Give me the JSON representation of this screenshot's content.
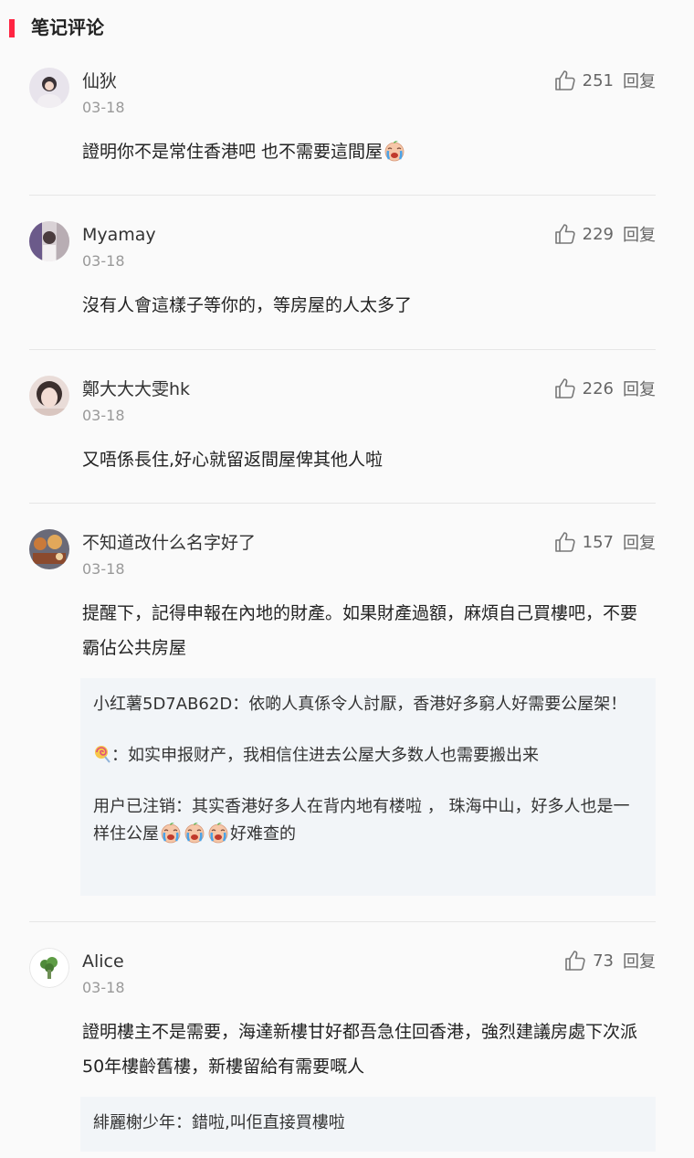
{
  "section": {
    "title": "笔记评论"
  },
  "comments": [
    {
      "username": "仙狄",
      "date": "03-18",
      "likes": "251",
      "reply_label": "回复",
      "text": "證明你不是常住香港吧 也不需要這間屋",
      "emoji": "crying-baby-emoji"
    },
    {
      "username": "Myamay",
      "date": "03-18",
      "likes": "229",
      "reply_label": "回复",
      "text": "沒有人會這樣子等你的，等房屋的人太多了"
    },
    {
      "username": "鄭大大大雯hk",
      "date": "03-18",
      "likes": "226",
      "reply_label": "回复",
      "text": "又唔係長住,好心就留返間屋俾其他人啦"
    },
    {
      "username": "不知道改什么名字好了",
      "date": "03-18",
      "likes": "157",
      "reply_label": "回复",
      "text": "提醒下，記得申報在內地的財產。如果財產過額，麻煩自己買樓吧，不要霸佔公共房屋",
      "replies": [
        {
          "author": "小红薯5D7AB62D",
          "sep": "：",
          "text": "依啲人真係令人討厭，香港好多窮人好需要公屋架！"
        },
        {
          "author": "",
          "author_icon": "lollipop-icon",
          "sep": "：",
          "text": "如实申报财产，我相信住进去公屋大多数人也需要搬出来"
        },
        {
          "author": "用户已注销",
          "sep": "：",
          "text": "其实香港好多人在背内地有楼啦 ， 珠海中山，好多人也是一样住公屋",
          "text_after": "好难查的"
        }
      ]
    },
    {
      "username": "Alice",
      "date": "03-18",
      "likes": "73",
      "reply_label": "回复",
      "text": "證明樓主不是需要，海達新樓甘好都吾急住回香港，強烈建議房處下次派50年樓齡舊樓，新樓留給有需要嘅人",
      "replies": [
        {
          "author": "緋麗榭少年",
          "sep": "：",
          "text": "錯啦,叫佢直接買樓啦"
        }
      ]
    }
  ]
}
